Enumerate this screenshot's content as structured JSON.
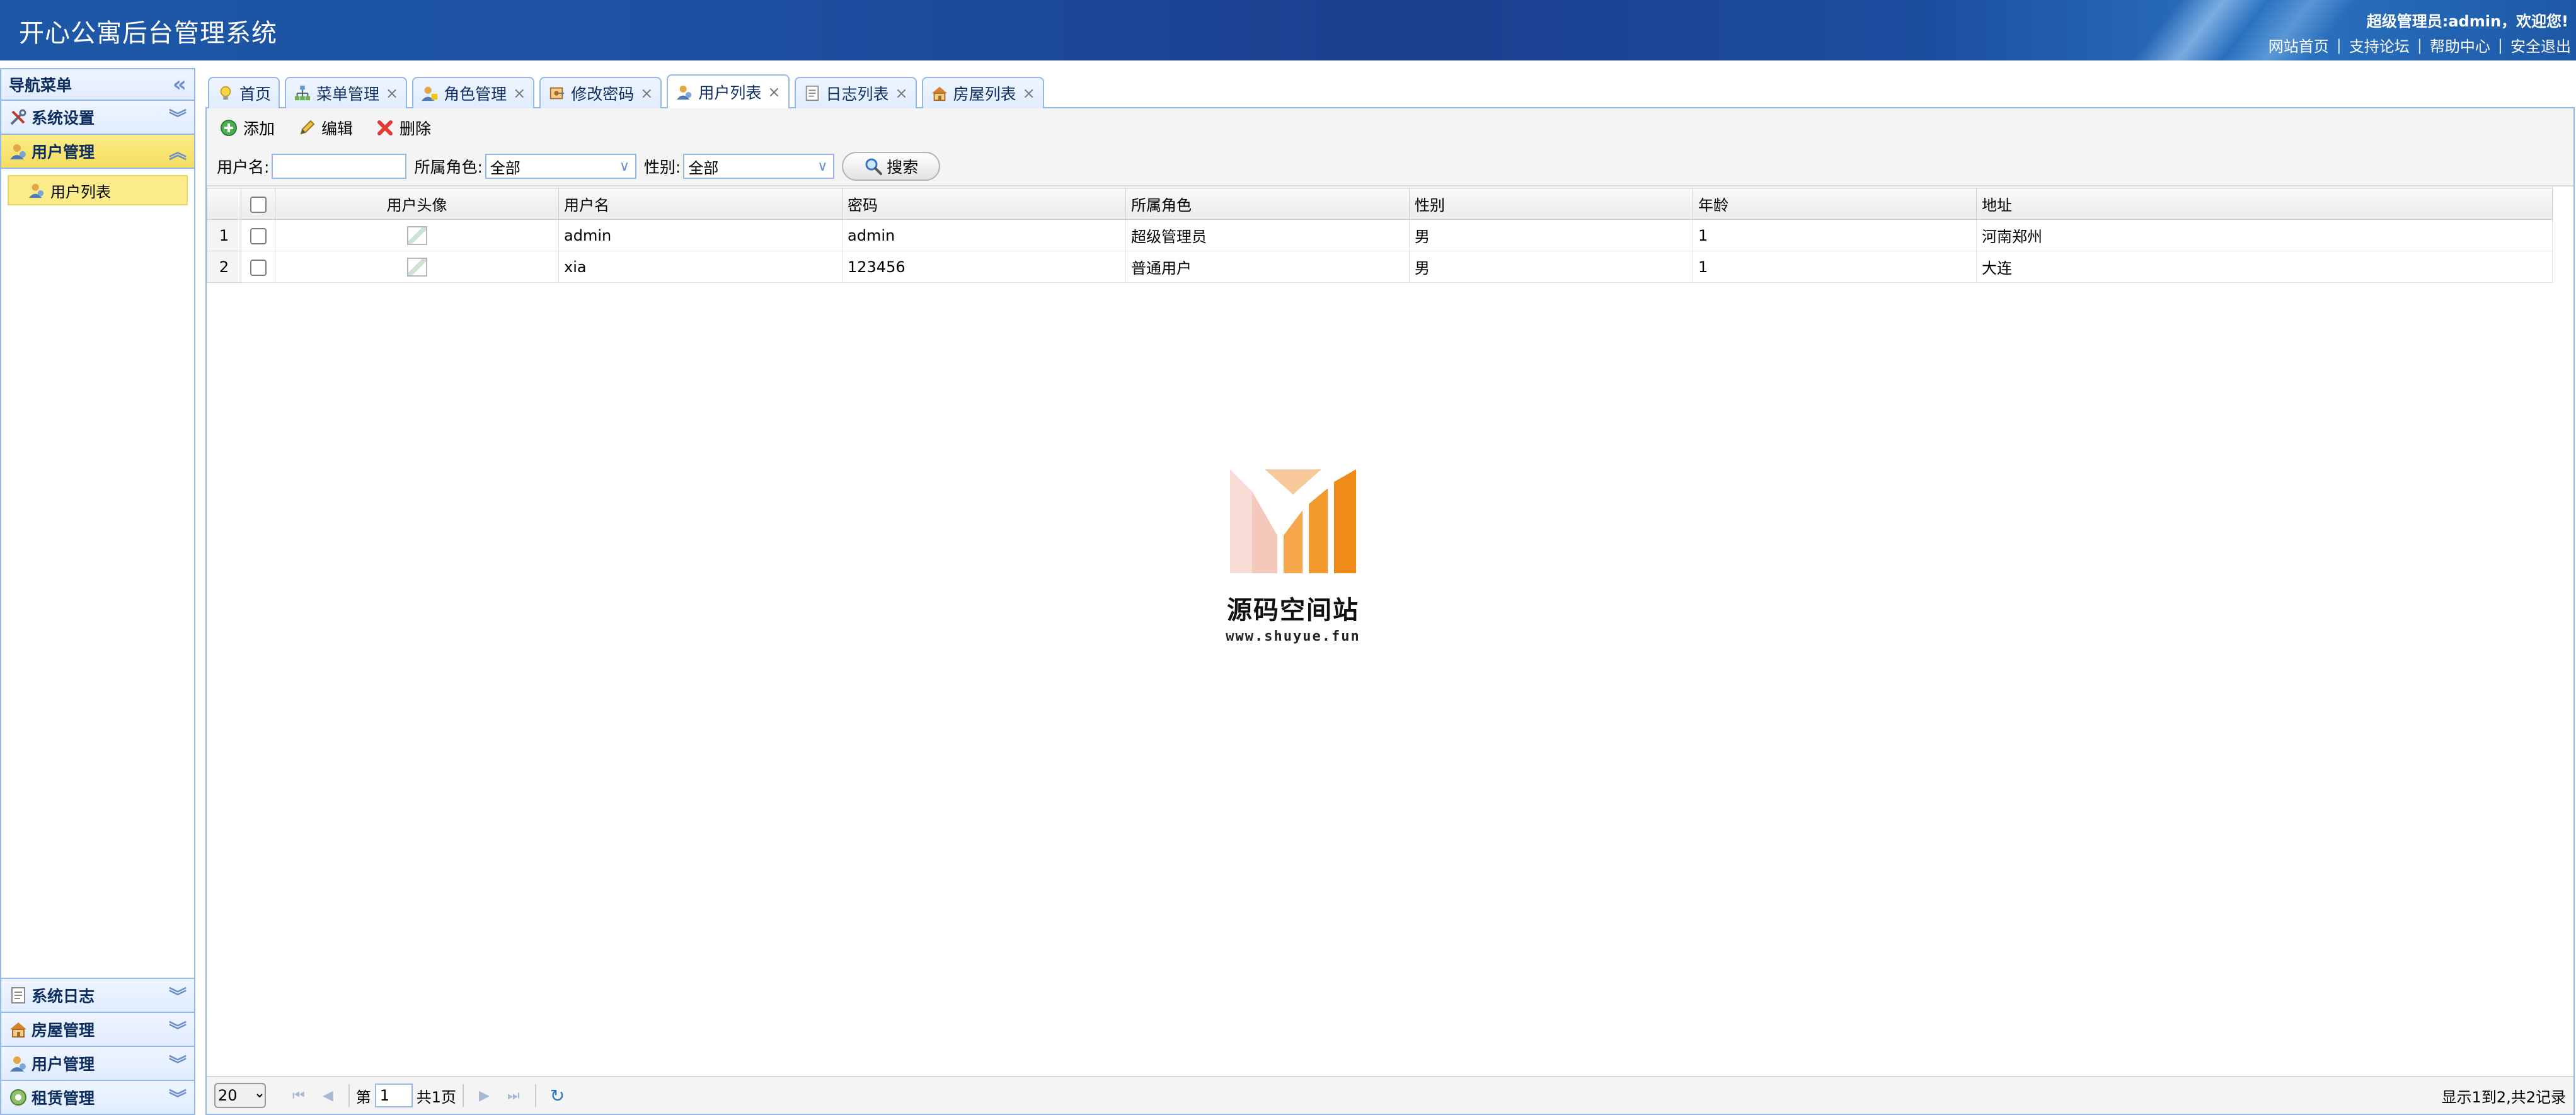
{
  "header": {
    "title": "开心公寓后台管理系统",
    "welcome": "超级管理员:admin，欢迎您!",
    "links": [
      "网站首页",
      "支持论坛",
      "帮助中心",
      "安全退出"
    ]
  },
  "nav": {
    "title": "导航菜单",
    "top_panels": [
      {
        "label": "系统设置",
        "icon": "tools-icon"
      },
      {
        "label": "用户管理",
        "icon": "user-icon",
        "selected": true
      }
    ],
    "tree_item": "用户列表",
    "bottom_panels": [
      {
        "label": "系统日志",
        "icon": "log-icon"
      },
      {
        "label": "房屋管理",
        "icon": "house-icon"
      },
      {
        "label": "用户管理",
        "icon": "user-icon"
      },
      {
        "label": "租赁管理",
        "icon": "lease-icon"
      }
    ]
  },
  "tabs": [
    {
      "label": "首页",
      "icon": "bulb-icon",
      "closable": false
    },
    {
      "label": "菜单管理",
      "icon": "sitemap-icon",
      "closable": true
    },
    {
      "label": "角色管理",
      "icon": "role-icon",
      "closable": true
    },
    {
      "label": "修改密码",
      "icon": "key-icon",
      "closable": true
    },
    {
      "label": "用户列表",
      "icon": "user-icon",
      "closable": true,
      "active": true
    },
    {
      "label": "日志列表",
      "icon": "log-icon",
      "closable": true
    },
    {
      "label": "房屋列表",
      "icon": "house-icon",
      "closable": true
    }
  ],
  "toolbar": {
    "add": "添加",
    "edit": "编辑",
    "delete": "删除"
  },
  "search": {
    "username_label": "用户名:",
    "username_value": "",
    "role_label": "所属角色:",
    "role_value": "全部",
    "gender_label": "性别:",
    "gender_value": "全部",
    "search_button": "搜索"
  },
  "grid": {
    "columns": [
      "用户头像",
      "用户名",
      "密码",
      "所属角色",
      "性别",
      "年龄",
      "地址"
    ],
    "rows": [
      {
        "num": "1",
        "username": "admin",
        "password": "admin",
        "role": "超级管理员",
        "gender": "男",
        "age": "1",
        "address": "河南郑州"
      },
      {
        "num": "2",
        "username": "xia",
        "password": "123456",
        "role": "普通用户",
        "gender": "男",
        "age": "1",
        "address": "大连"
      }
    ]
  },
  "watermark": {
    "text": "源码空间站",
    "url": "www.shuyue.fun"
  },
  "pager": {
    "page_size": "20",
    "page_prefix": "第",
    "page_number": "1",
    "page_total": "共1页",
    "info": "显示1到2,共2记录"
  },
  "colors": {
    "header_blue": "#1d4fa0",
    "border_blue": "#95b8e7",
    "selected_yellow": "#fbec88",
    "logo_orange": "#f39a2e"
  }
}
